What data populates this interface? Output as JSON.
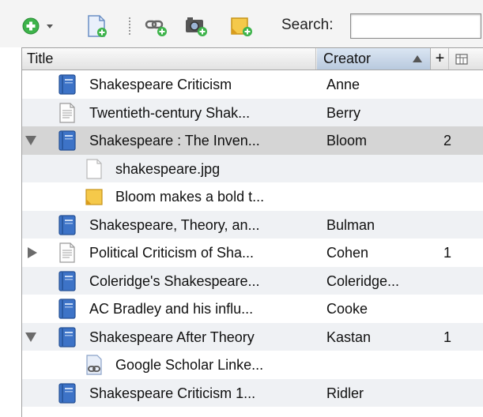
{
  "toolbar": {
    "new_item_icon": "green-plus-icon",
    "search_label": "Search:",
    "search_value": ""
  },
  "columns": {
    "title": "Title",
    "creator": "Creator",
    "add": "+"
  },
  "rows": [
    {
      "title": "Shakespeare Criticism",
      "creator": "Anne",
      "count": "",
      "type": "book",
      "level": 0,
      "disclosure": "none",
      "shade": "none"
    },
    {
      "title": "Twentieth-century Shak...",
      "creator": "Berry",
      "count": "",
      "type": "document",
      "level": 0,
      "disclosure": "none",
      "shade": "alt"
    },
    {
      "title": "Shakespeare : The Inven...",
      "creator": "Bloom",
      "count": "2",
      "type": "book",
      "level": 0,
      "disclosure": "open",
      "shade": "sel"
    },
    {
      "title": "shakespeare.jpg",
      "creator": "",
      "count": "",
      "type": "file",
      "level": 1,
      "disclosure": "none",
      "shade": "alt"
    },
    {
      "title": "Bloom makes a bold t...",
      "creator": "",
      "count": "",
      "type": "note",
      "level": 1,
      "disclosure": "none",
      "shade": "none"
    },
    {
      "title": "Shakespeare, Theory, an...",
      "creator": "Bulman",
      "count": "",
      "type": "book",
      "level": 0,
      "disclosure": "none",
      "shade": "alt"
    },
    {
      "title": "Political Criticism of Sha...",
      "creator": "Cohen",
      "count": "1",
      "type": "document",
      "level": 0,
      "disclosure": "closed",
      "shade": "none"
    },
    {
      "title": "Coleridge's Shakespeare...",
      "creator": "Coleridge...",
      "count": "",
      "type": "book",
      "level": 0,
      "disclosure": "none",
      "shade": "alt"
    },
    {
      "title": "AC Bradley and his influ...",
      "creator": "Cooke",
      "count": "",
      "type": "book",
      "level": 0,
      "disclosure": "none",
      "shade": "none"
    },
    {
      "title": "Shakespeare After Theory",
      "creator": "Kastan",
      "count": "1",
      "type": "book",
      "level": 0,
      "disclosure": "open",
      "shade": "alt"
    },
    {
      "title": "Google Scholar Linke...",
      "creator": "",
      "count": "",
      "type": "link",
      "level": 1,
      "disclosure": "none",
      "shade": "none"
    },
    {
      "title": "Shakespeare Criticism 1...",
      "creator": "Ridler",
      "count": "",
      "type": "book",
      "level": 0,
      "disclosure": "none",
      "shade": "alt"
    }
  ],
  "colors": {
    "accent_green": "#3db34a",
    "book_blue": "#3d73c7",
    "note_yellow": "#f2c040",
    "selected_row": "#d5d5d5",
    "alt_row": "#eff1f4"
  }
}
